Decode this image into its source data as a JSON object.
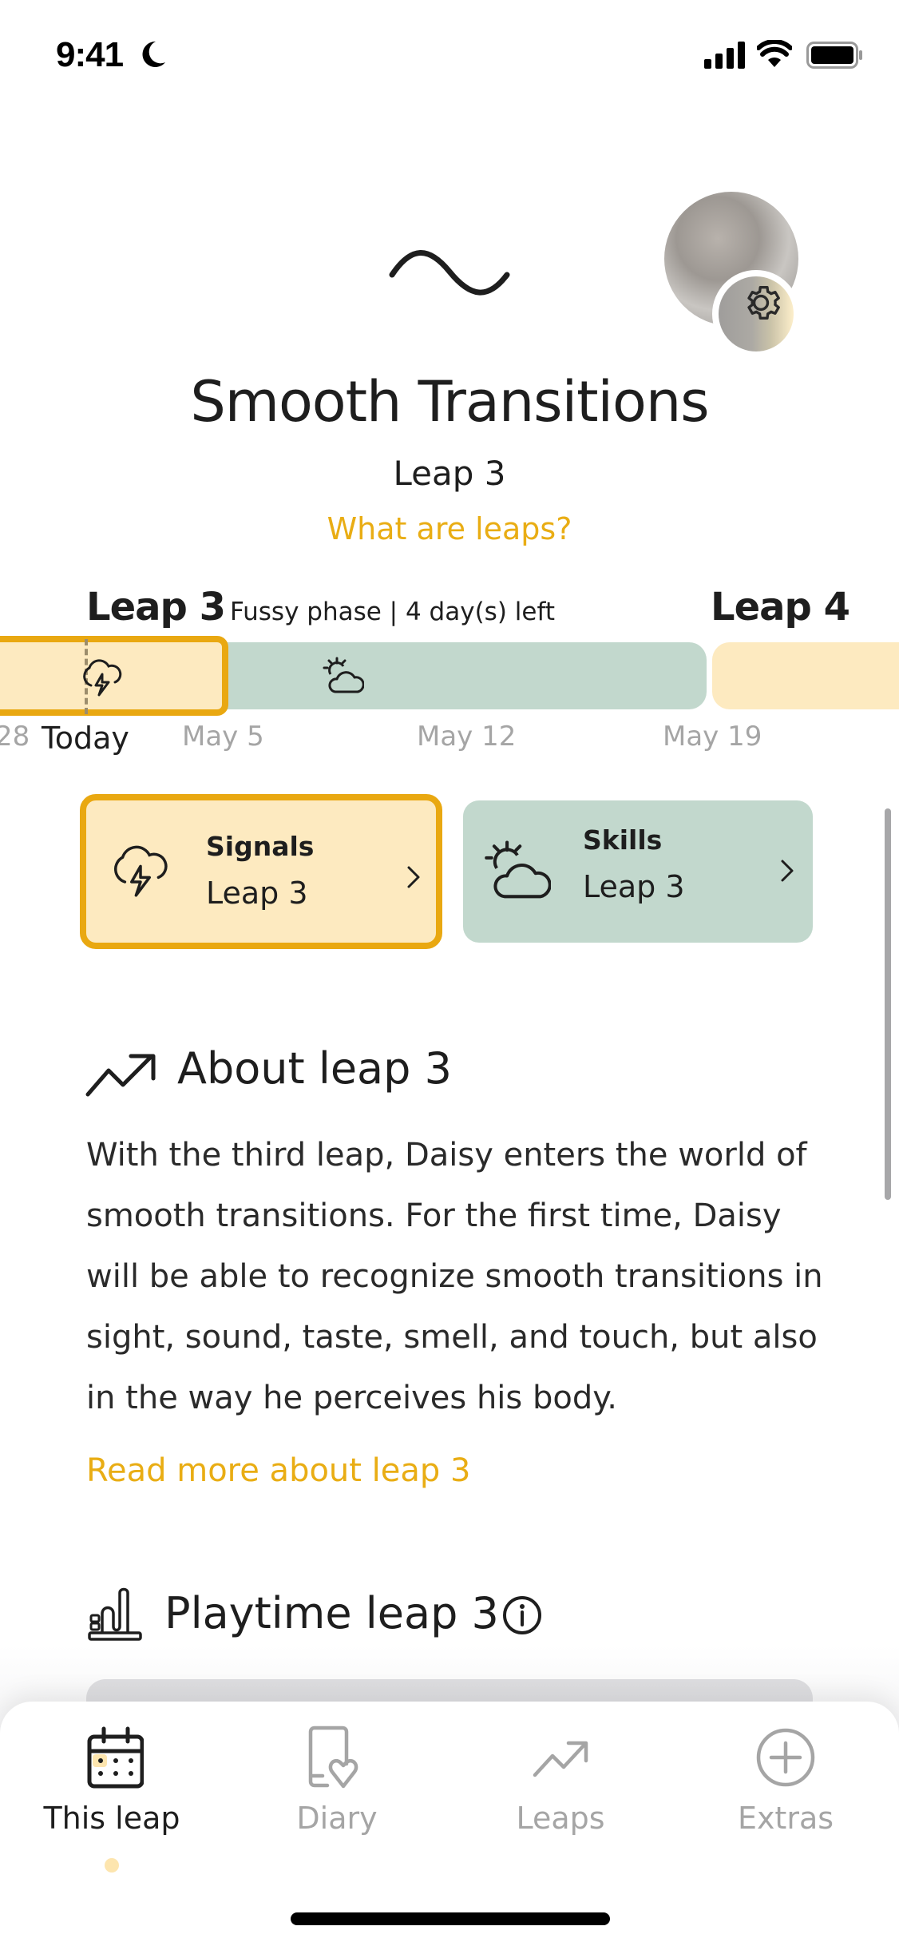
{
  "status_bar": {
    "time": "9:41",
    "icons": [
      "moon-icon",
      "signal-icon",
      "wifi-icon",
      "battery-icon"
    ]
  },
  "header": {
    "leap_icon": "wave-icon",
    "title": "Smooth Transitions",
    "subtitle": "Leap 3",
    "what_link": "What are leaps?",
    "avatar_badge_icon": "gear-icon"
  },
  "timeline": {
    "current_leap": "Leap 3",
    "status": "Fussy phase | 4 day(s) left",
    "next_leap": "Leap 4",
    "today_label": "Today",
    "dates": [
      "28",
      "May 5",
      "May 12",
      "May 19"
    ],
    "segments": [
      {
        "name": "fussy-phase",
        "icon": "storm-cloud-icon",
        "color": "#fdeac0",
        "border": "#e9a811"
      },
      {
        "name": "skills-phase",
        "icon": "sun-cloud-icon",
        "color": "#c2d8cd"
      },
      {
        "name": "next-leap",
        "color": "#fdeac0"
      }
    ]
  },
  "cards": [
    {
      "title": "Signals",
      "subtitle": "Leap 3",
      "icon": "storm-cloud-icon",
      "color": "#fdeac0"
    },
    {
      "title": "Skills",
      "subtitle": "Leap 3",
      "icon": "sun-cloud-icon",
      "color": "#c2d8cd"
    }
  ],
  "about": {
    "icon": "trend-up-icon",
    "title": "About leap 3",
    "body": "With the third leap, Daisy  enters the world of smooth transitions. For the first time, Daisy will be able to recognize smooth transitions in sight, sound, taste, smell, and touch, but also in the way he perceives his body.",
    "read_more": "Read more about leap 3"
  },
  "playtime": {
    "icon": "toy-icon",
    "title": "Playtime leap 3",
    "info_icon": "info-icon"
  },
  "tab_bar": {
    "active": 0,
    "tabs": [
      {
        "label": "This leap",
        "icon": "calendar-icon"
      },
      {
        "label": "Diary",
        "icon": "diary-heart-icon"
      },
      {
        "label": "Leaps",
        "icon": "trend-up-icon"
      },
      {
        "label": "Extras",
        "icon": "plus-circle-icon"
      }
    ]
  },
  "colors": {
    "accent": "#e9ad14",
    "fussy": "#fdeac0",
    "skills": "#c2d8cd",
    "text": "#1e1e1e",
    "muted": "#a5a5a5"
  }
}
